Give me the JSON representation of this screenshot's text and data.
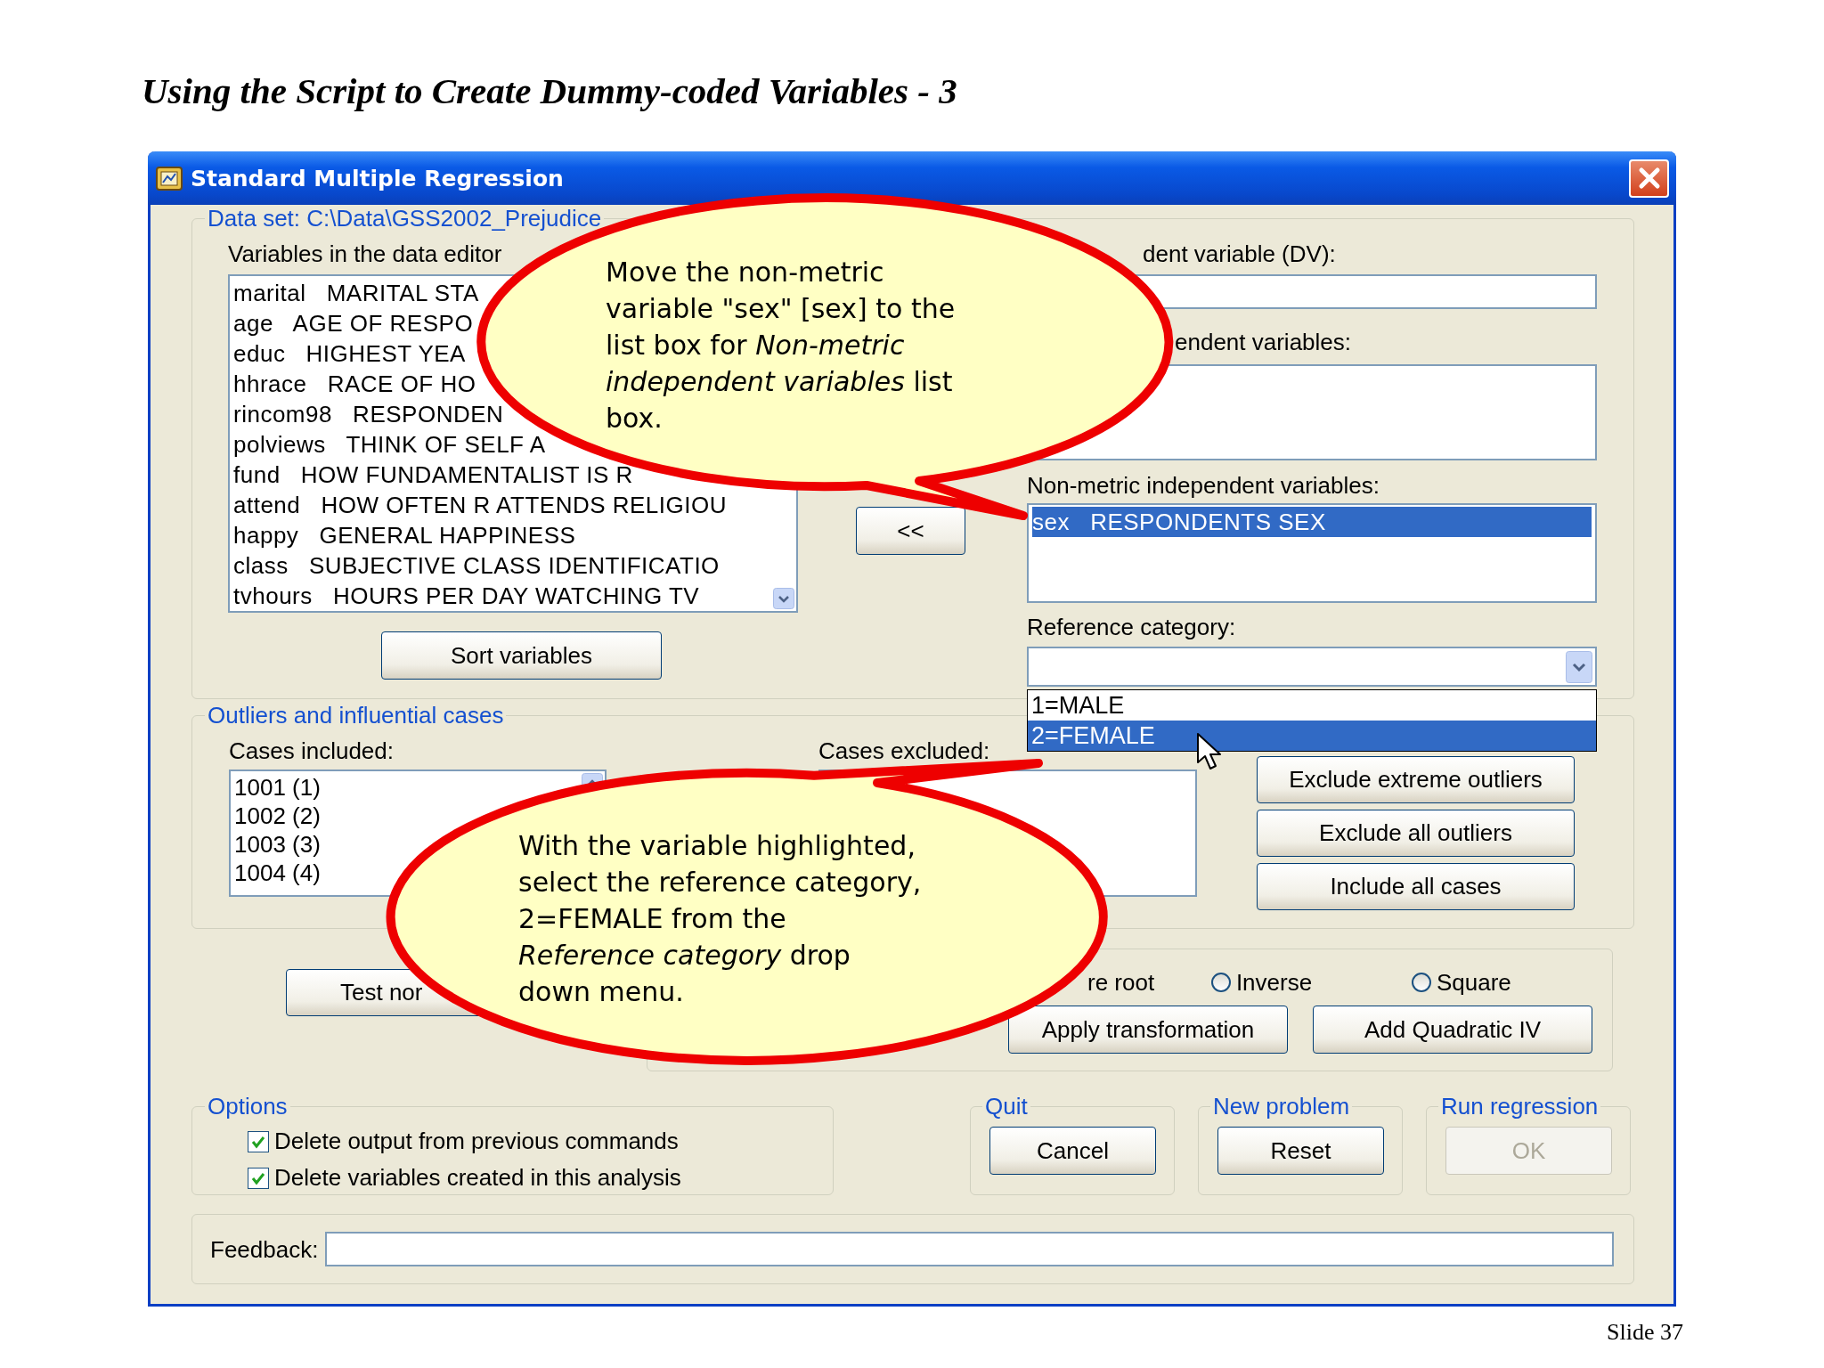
{
  "slide_title": "Using the Script to Create Dummy-coded Variables - 3",
  "window": {
    "title": "Standard Multiple Regression"
  },
  "variables_group": {
    "legend": "Data set: C:\\Data\\GSS2002_Prejudice",
    "list_label": "Variables in the data editor",
    "variables": [
      {
        "text": "marital   MARITAL STA",
        "selected": false
      },
      {
        "text": "age   AGE OF RESPO",
        "selected": false
      },
      {
        "text": "educ   HIGHEST YEA",
        "selected": false
      },
      {
        "text": "hhrace   RACE OF HO",
        "selected": false
      },
      {
        "text": "rincom98   RESPONDEN",
        "selected": false
      },
      {
        "text": "polviews   THINK OF SELF A",
        "selected": false
      },
      {
        "text": "fund   HOW FUNDAMENTALIST IS R",
        "selected": false
      },
      {
        "text": "attend   HOW OFTEN R ATTENDS RELIGIOU",
        "selected": false
      },
      {
        "text": "happy   GENERAL HAPPINESS",
        "selected": false
      },
      {
        "text": "class   SUBJECTIVE CLASS IDENTIFICATIO",
        "selected": false
      },
      {
        "text": "tvhours   HOURS PER DAY WATCHING TV",
        "selected": false
      }
    ],
    "sort_button": "Sort variables",
    "move_back_button": "<<",
    "dv_label": "dent variable (DV):",
    "metric_label": "endent variables:",
    "nonmetric_label": "Non-metric independent variables:",
    "nonmetric_variables": [
      {
        "text": "sex   RESPONDENTS SEX",
        "selected": true
      }
    ],
    "reference_label": "Reference category:",
    "reference_options": [
      {
        "text": "1=MALE",
        "selected": false
      },
      {
        "text": "2=FEMALE",
        "selected": true
      }
    ]
  },
  "outliers_group": {
    "legend": "Outliers and influential cases",
    "included_label": "Cases included:",
    "included_cases": [
      "1001 (1)",
      "1002 (2)",
      "1003 (3)",
      "1004 (4)"
    ],
    "excluded_label": "Cases excluded:",
    "buttons": [
      "Exclude extreme outliers",
      "Exclude all outliers",
      "Include all cases"
    ]
  },
  "test_button": "Test nor",
  "transformations": {
    "partial_label": "re root",
    "radios": [
      {
        "label": "Inverse",
        "selected": false
      },
      {
        "label": "Square",
        "selected": false
      }
    ],
    "buttons": [
      "Apply transformation",
      "Add Quadratic IV"
    ]
  },
  "options_group": {
    "legend": "Options",
    "checkboxes": [
      {
        "label": "Delete output from previous commands",
        "checked": true
      },
      {
        "label": "Delete variables created in this analysis",
        "checked": true
      }
    ]
  },
  "action_groups": [
    {
      "legend": "Quit",
      "button": "Cancel",
      "disabled": false
    },
    {
      "legend": "New problem",
      "button": "Reset",
      "disabled": false
    },
    {
      "legend": "Run regression",
      "button": "OK",
      "disabled": true
    }
  ],
  "feedback": {
    "label": "Feedback:"
  },
  "callouts": [
    {
      "text": "Move the non-metric\nvariable \"sex\" [sex] to the\nlist box for *Non-metric*\n*independent variables* list\nbox."
    },
    {
      "text": "With the variable highlighted,\nselect the reference category,\n2=FEMALE from the\n*Reference category* drop\ndown menu."
    }
  ],
  "slide_number": "Slide 37"
}
